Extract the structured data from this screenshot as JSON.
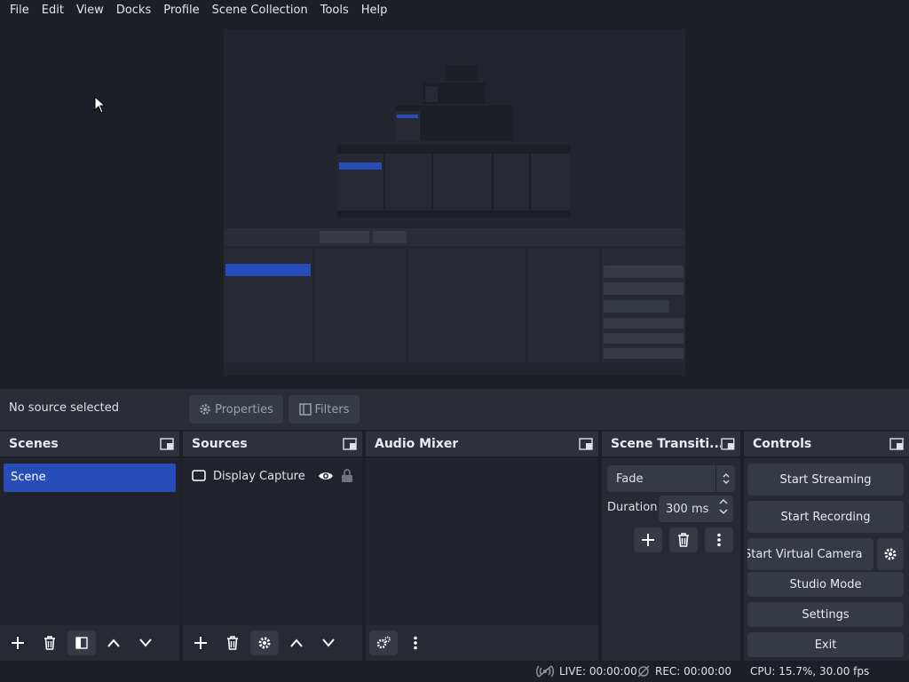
{
  "menu": {
    "items": [
      "File",
      "Edit",
      "View",
      "Docks",
      "Profile",
      "Scene Collection",
      "Tools",
      "Help"
    ]
  },
  "source_toolbar": {
    "no_source": "No source selected",
    "properties_label": "Properties",
    "filters_label": "Filters"
  },
  "docks": {
    "scenes": {
      "title": "Scenes",
      "items": [
        "Scene"
      ]
    },
    "sources": {
      "title": "Sources",
      "items": [
        {
          "name": "Display Capture"
        }
      ]
    },
    "audio_mixer": {
      "title": "Audio Mixer"
    },
    "scene_transitions": {
      "title": "Scene Transiti...",
      "transition": "Fade",
      "duration_label": "Duration",
      "duration_value": "300 ms"
    },
    "controls": {
      "title": "Controls",
      "start_streaming": "Start Streaming",
      "start_recording": "Start Recording",
      "start_virtual_camera": "Start Virtual Camera",
      "studio_mode": "Studio Mode",
      "settings": "Settings",
      "exit": "Exit"
    }
  },
  "status": {
    "live": "LIVE: 00:00:00",
    "rec": "REC: 00:00:00",
    "cpu": "CPU: 15.7%, 30.00 fps"
  },
  "colors": {
    "background": "#1d1f26",
    "panel": "#272a33",
    "button": "#363a45",
    "selected_scene": "#284cb8"
  }
}
